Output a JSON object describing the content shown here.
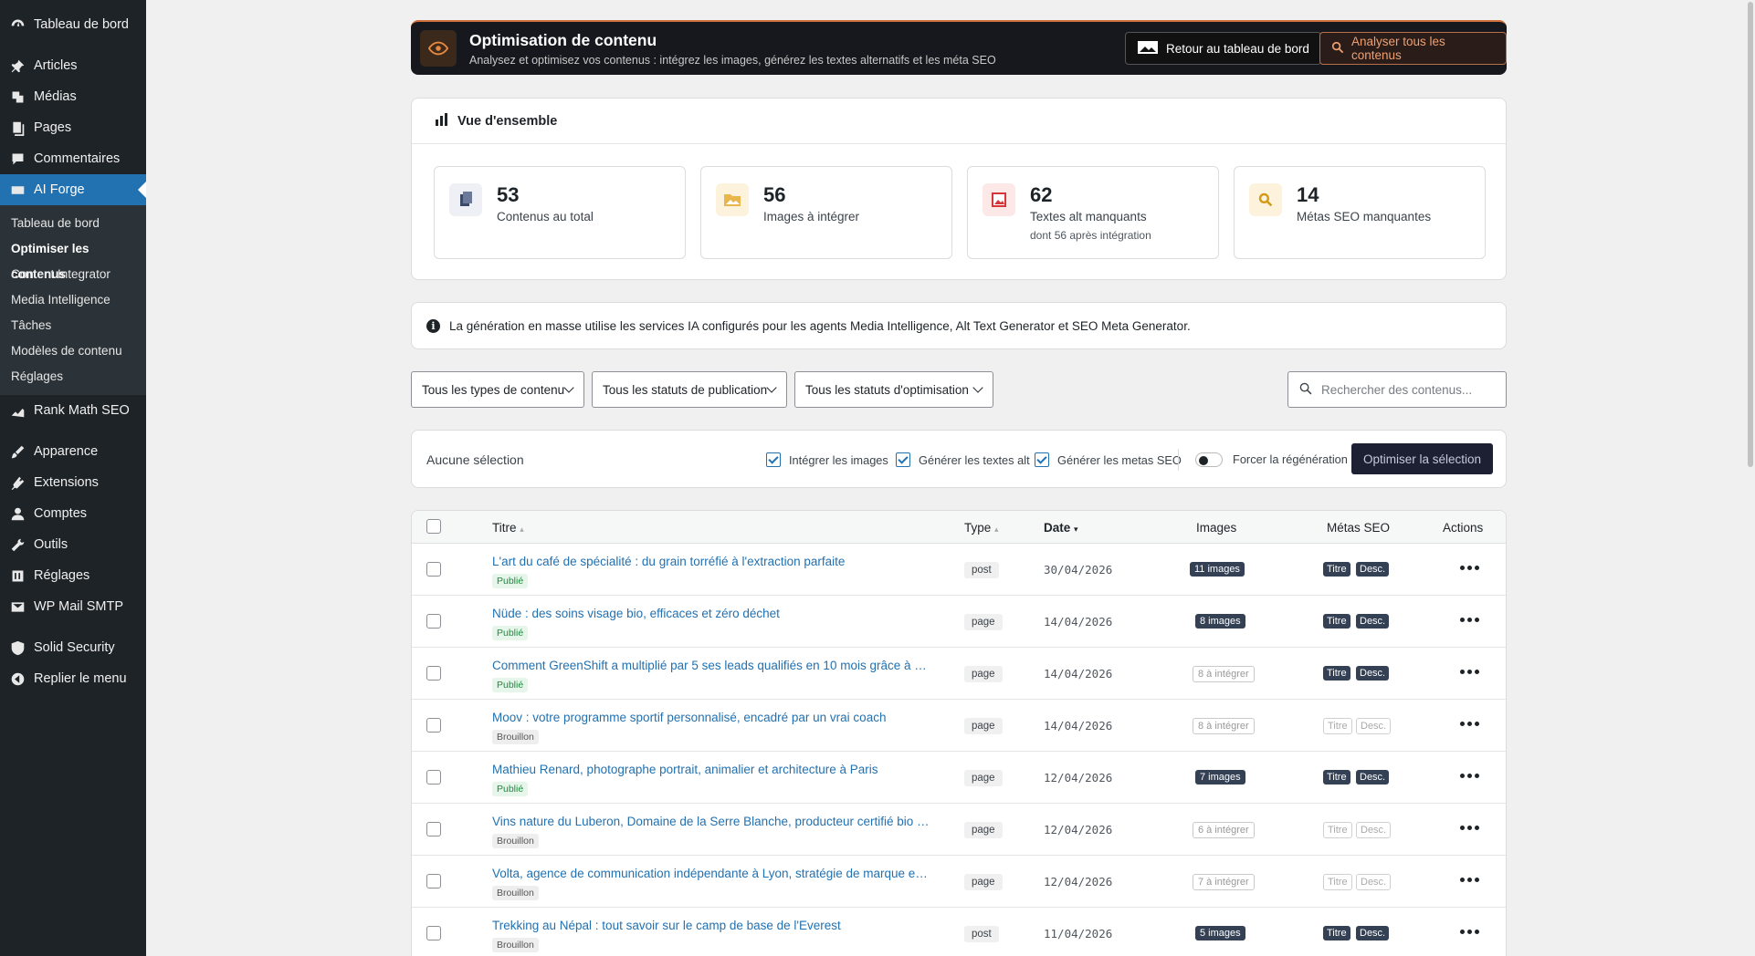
{
  "sidebar": {
    "items": [
      {
        "label": "Tableau de bord",
        "icon": "dashboard-icon"
      },
      {
        "label": "Articles",
        "icon": "pin-icon"
      },
      {
        "label": "Médias",
        "icon": "media-icon"
      },
      {
        "label": "Pages",
        "icon": "pages-icon"
      },
      {
        "label": "Commentaires",
        "icon": "comment-icon"
      },
      {
        "label": "AI Forge",
        "icon": "ai-forge-icon"
      },
      {
        "label": "Rank Math SEO",
        "icon": "rank-math-icon"
      },
      {
        "label": "Apparence",
        "icon": "brush-icon"
      },
      {
        "label": "Extensions",
        "icon": "plugin-icon"
      },
      {
        "label": "Comptes",
        "icon": "user-icon"
      },
      {
        "label": "Outils",
        "icon": "wrench-icon"
      },
      {
        "label": "Réglages",
        "icon": "settings-icon"
      },
      {
        "label": "WP Mail SMTP",
        "icon": "mail-icon"
      },
      {
        "label": "Solid Security",
        "icon": "shield-icon"
      },
      {
        "label": "Replier le menu",
        "icon": "collapse-icon"
      }
    ],
    "submenu": [
      "Tableau de bord",
      "Optimiser les contenus",
      "Content Integrator",
      "Media Intelligence",
      "Tâches",
      "Modèles de contenu",
      "Réglages"
    ]
  },
  "header": {
    "title": "Optimisation de contenu",
    "subtitle": "Analysez et optimisez vos contenus : intégrez les images, générez les textes alternatifs et les méta SEO",
    "back_label": "Retour au tableau de bord",
    "analyze_label": "Analyser tous les contenus"
  },
  "overview": {
    "title": "Vue d'ensemble",
    "stats": [
      {
        "value": "53",
        "label": "Contenus au total",
        "sub": ""
      },
      {
        "value": "56",
        "label": "Images à intégrer",
        "sub": ""
      },
      {
        "value": "62",
        "label": "Textes alt manquants",
        "sub": "dont 56 après intégration"
      },
      {
        "value": "14",
        "label": "Métas SEO manquantes",
        "sub": ""
      }
    ]
  },
  "info": "La génération en masse utilise les services IA configurés pour les agents Media Intelligence, Alt Text Generator et SEO Meta Generator.",
  "filters": {
    "type": "Tous les types de contenu",
    "publication": "Tous les statuts de publication",
    "optimization": "Tous les statuts d'optimisation",
    "search_placeholder": "Rechercher des contenus..."
  },
  "actionbar": {
    "selection": "Aucune sélection",
    "opt_images": "Intégrer les images",
    "opt_alt": "Générer les textes alt",
    "opt_meta": "Générer les metas SEO",
    "force": "Forcer la régénération",
    "optimize": "Optimiser la sélection"
  },
  "table": {
    "headers": {
      "title": "Titre",
      "type": "Type",
      "date": "Date",
      "images": "Images",
      "meta": "Métas SEO",
      "actions": "Actions"
    },
    "rows": [
      {
        "title": "L'art du café de spécialité : du grain torréfié à l'extraction parfaite",
        "status": "Publié",
        "type": "post",
        "date": "30/04/2026",
        "images": "11 images",
        "images_done": true,
        "meta_title": "Titre",
        "meta_desc": "Desc.",
        "meta_done": true
      },
      {
        "title": "Nüde : des soins visage bio, efficaces et zéro déchet",
        "status": "Publié",
        "type": "page",
        "date": "14/04/2026",
        "images": "8 images",
        "images_done": true,
        "meta_title": "Titre",
        "meta_desc": "Desc.",
        "meta_done": true
      },
      {
        "title": "Comment GreenShift a multiplié par 5 ses leads qualifiés en 10 mois grâce à une r...",
        "status": "Publié",
        "type": "page",
        "date": "14/04/2026",
        "images": "8 à intégrer",
        "images_done": false,
        "meta_title": "Titre",
        "meta_desc": "Desc.",
        "meta_done": true
      },
      {
        "title": "Moov : votre programme sportif personnalisé, encadré par un vrai coach",
        "status": "Brouillon",
        "type": "page",
        "date": "14/04/2026",
        "images": "8 à intégrer",
        "images_done": false,
        "meta_title": "Titre",
        "meta_desc": "Desc.",
        "meta_done": false
      },
      {
        "title": "Mathieu Renard, photographe portrait, animalier et architecture à Paris",
        "status": "Publié",
        "type": "page",
        "date": "12/04/2026",
        "images": "7 images",
        "images_done": true,
        "meta_title": "Titre",
        "meta_desc": "Desc.",
        "meta_done": true
      },
      {
        "title": "Vins nature du Luberon, Domaine de la Serre Blanche, producteur certifié bio et bi...",
        "status": "Brouillon",
        "type": "page",
        "date": "12/04/2026",
        "images": "6 à intégrer",
        "images_done": false,
        "meta_title": "Titre",
        "meta_desc": "Desc.",
        "meta_done": false
      },
      {
        "title": "Volta, agence de communication indépendante à Lyon, stratégie de marque et co...",
        "status": "Brouillon",
        "type": "page",
        "date": "12/04/2026",
        "images": "7 à intégrer",
        "images_done": false,
        "meta_title": "Titre",
        "meta_desc": "Desc.",
        "meta_done": false
      },
      {
        "title": "Trekking au Népal : tout savoir sur le camp de base de l'Everest",
        "status": "Brouillon",
        "type": "post",
        "date": "11/04/2026",
        "images": "5 images",
        "images_done": true,
        "meta_title": "Titre",
        "meta_desc": "Desc.",
        "meta_done": true
      }
    ]
  },
  "colors": {
    "accent": "#2271b1",
    "sidebar": "#1d2327",
    "header": "#17181d",
    "header_border": "#d0703a"
  }
}
